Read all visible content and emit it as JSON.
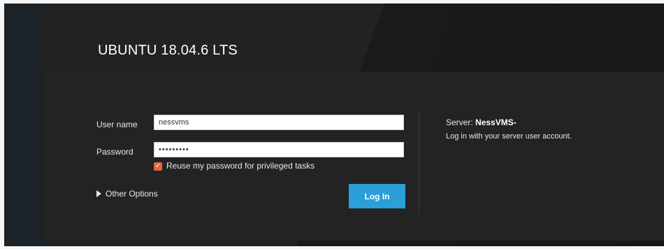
{
  "header": {
    "os_title": "UBUNTU 18.04.6 LTS"
  },
  "form": {
    "username_label": "User name",
    "username_value": "nessvms",
    "password_label": "Password",
    "password_value": "•••••••••",
    "reuse_password_label": "Reuse my password for privileged tasks",
    "reuse_password_checked": true,
    "other_options_label": "Other Options",
    "login_label": "Log In"
  },
  "server": {
    "prefix": "Server: ",
    "name": "NessVMS-",
    "description": "Log in with your server user account."
  },
  "colors": {
    "accent": "#2a9fd8",
    "checkbox": "#e4663a"
  }
}
